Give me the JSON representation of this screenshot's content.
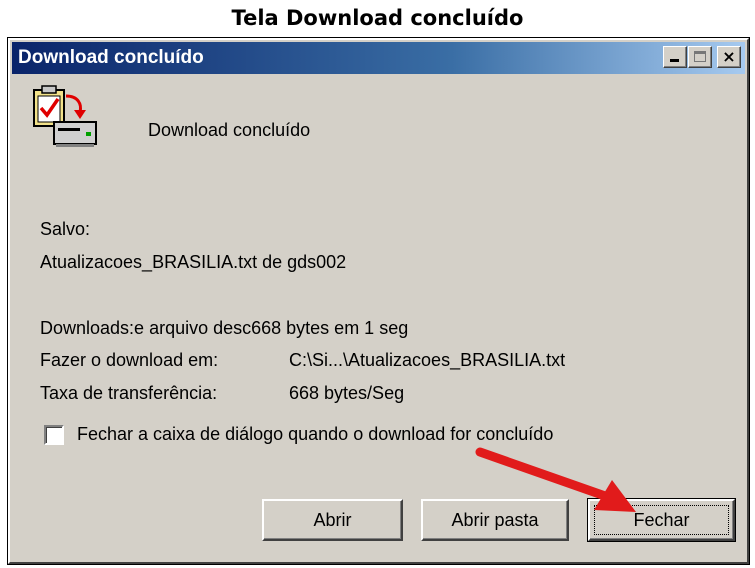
{
  "page_heading": "Tela Download concluído",
  "window": {
    "title": "Download concluído",
    "controls": {
      "minimize": "_",
      "maximize": "□",
      "close": "×"
    }
  },
  "dialog": {
    "status": "Download concluído",
    "saved_label": "Salvo:",
    "file_line": "Atualizacoes_BRASILIA.txt de gds002",
    "downloads_line": "Downloads:e arquivo desc668 bytes em 1 seg",
    "download_to_label": "Fazer o download em:",
    "download_to_value": "C:\\Si...\\Atualizacoes_BRASILIA.txt",
    "rate_label": "Taxa de transferência:",
    "rate_value": "668 bytes/Seg",
    "checkbox_label": "Fechar a caixa de diálogo quando o download for concluído",
    "checkbox_checked": false
  },
  "buttons": {
    "open": "Abrir",
    "open_folder": "Abrir pasta",
    "close": "Fechar"
  },
  "icons": {
    "download_complete": "download-complete-icon",
    "annotation_arrow": "red-arrow"
  },
  "colors": {
    "titlebar_start": "#0a246a",
    "titlebar_end": "#a6caf0",
    "window_face": "#d4d0c8",
    "arrow": "#e11b1b"
  }
}
